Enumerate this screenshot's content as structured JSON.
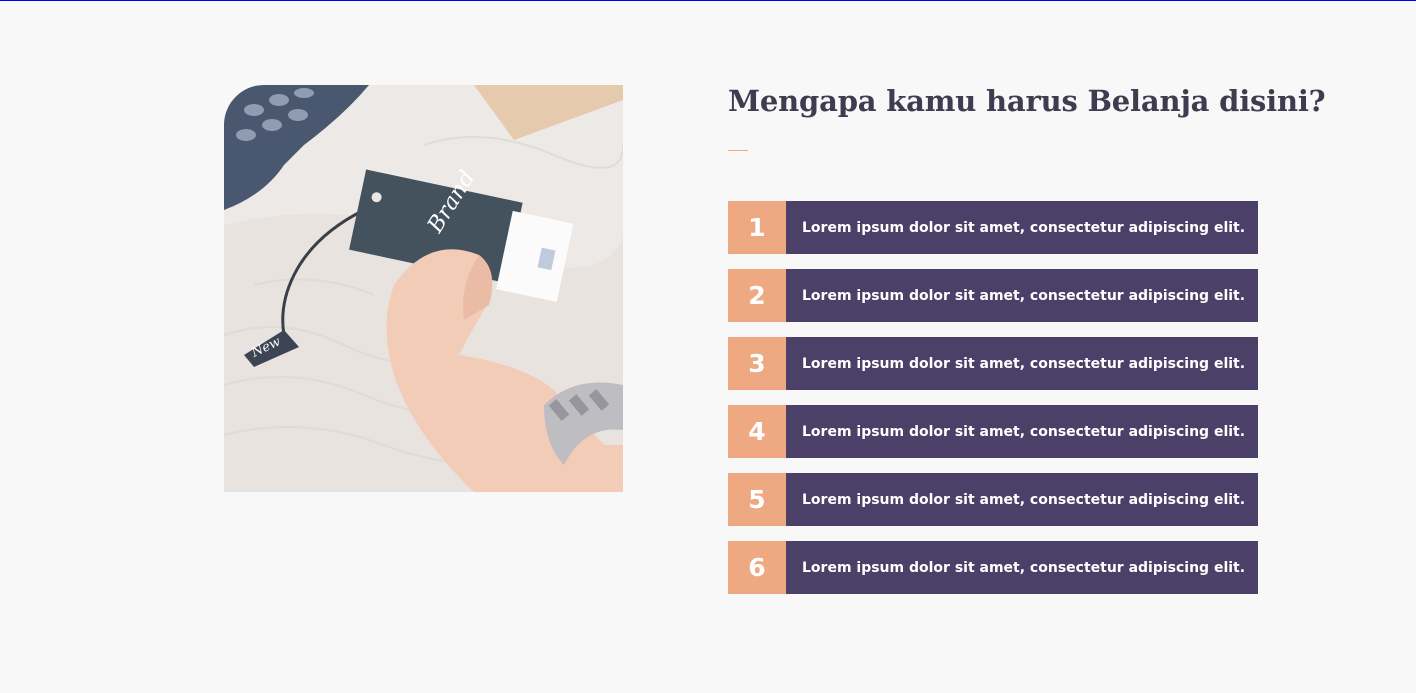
{
  "section": {
    "title": "Mengapa kamu harus Belanja disini?",
    "image": {
      "tag_text": "Brand",
      "small_tag_text": "New"
    },
    "accent_color": "#eea982",
    "box_color": "#4b4168",
    "items": [
      {
        "number": "1",
        "text": "Lorem ipsum dolor sit amet, consectetur adipiscing elit."
      },
      {
        "number": "2",
        "text": "Lorem ipsum dolor sit amet, consectetur adipiscing elit."
      },
      {
        "number": "3",
        "text": "Lorem ipsum dolor sit amet, consectetur adipiscing elit."
      },
      {
        "number": "4",
        "text": "Lorem ipsum dolor sit amet, consectetur adipiscing elit."
      },
      {
        "number": "5",
        "text": "Lorem ipsum dolor sit amet, consectetur adipiscing elit."
      },
      {
        "number": "6",
        "text": "Lorem ipsum dolor sit amet, consectetur adipiscing elit."
      }
    ]
  }
}
